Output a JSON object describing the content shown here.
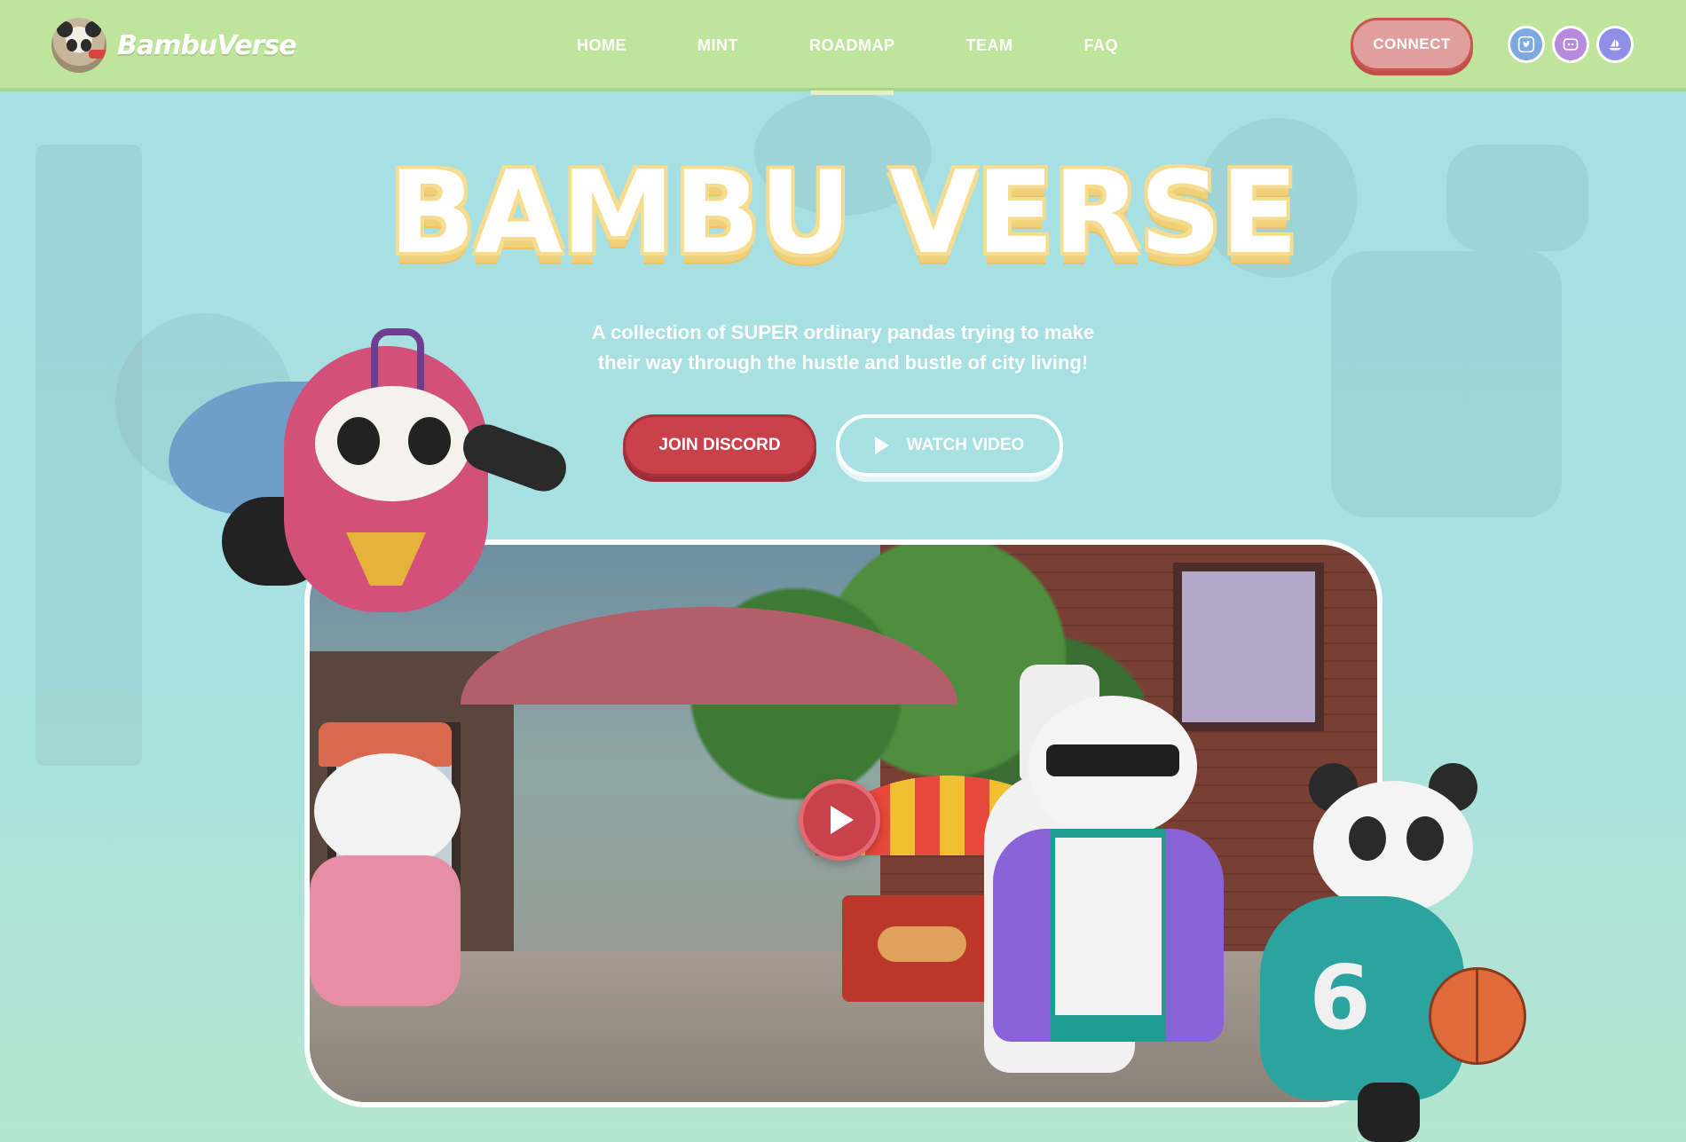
{
  "brand": {
    "name": "BambuVerse"
  },
  "nav": {
    "links": [
      {
        "label": "HOME",
        "active": false
      },
      {
        "label": "MINT",
        "active": false
      },
      {
        "label": "ROADMAP",
        "active": true
      },
      {
        "label": "TEAM",
        "active": false
      },
      {
        "label": "FAQ",
        "active": false
      }
    ],
    "connect_label": "CONNECT",
    "socials": [
      "twitter-icon",
      "discord-icon",
      "opensea-icon"
    ]
  },
  "hero": {
    "title": "BAMBU VERSE",
    "tagline_line1": "A collection of SUPER ordinary pandas trying to make",
    "tagline_line2": "their way through the hustle and bustle of city living!",
    "join_label": "JOIN DISCORD",
    "watch_label": "WATCH VIDEO"
  },
  "characters": {
    "basketball_jersey_number": "6"
  },
  "colors": {
    "nav_bg": "#bfe49c",
    "page_bg": "#a6e0e5",
    "primary_red": "#c8414b",
    "connect_pink": "#e09f9c",
    "title_outline": "#f6dc8e"
  }
}
